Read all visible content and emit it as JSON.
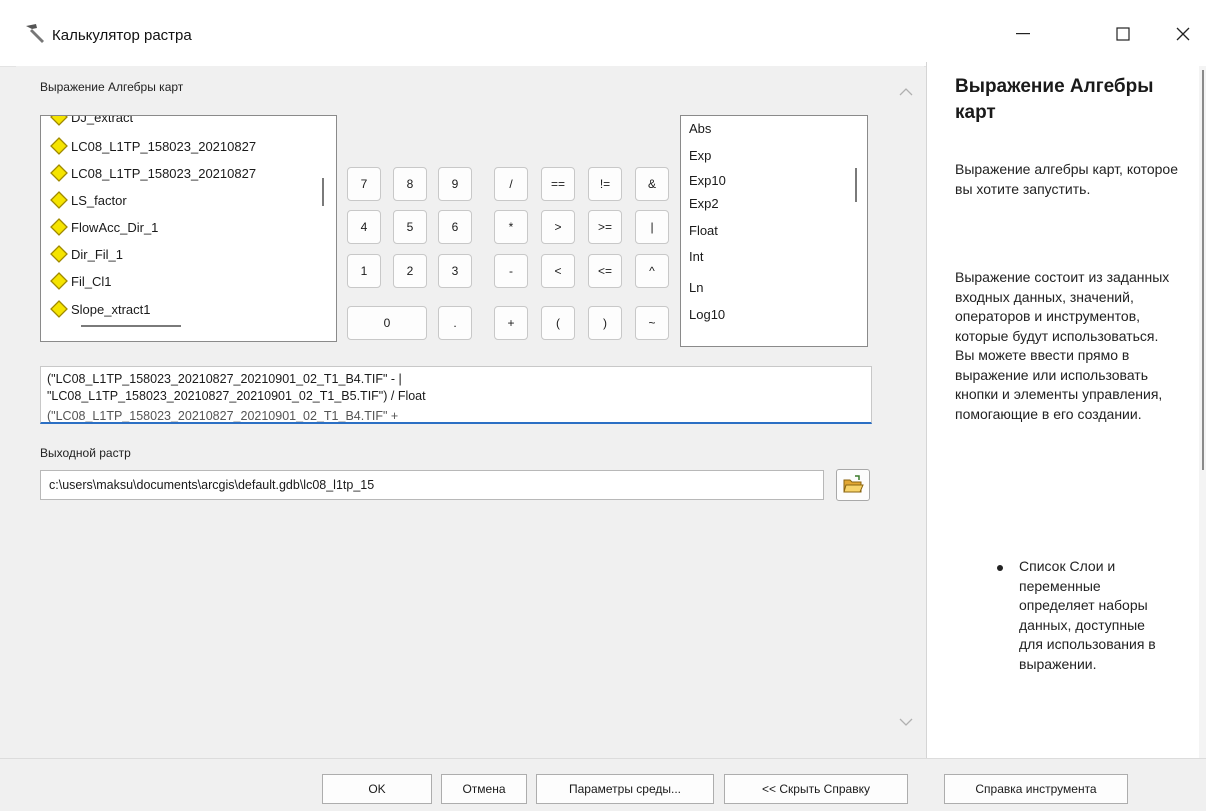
{
  "window": {
    "title": "Калькулятор растра"
  },
  "labels": {
    "map_algebra": "Выражение Алгебры карт",
    "output_raster": "Выходной растр"
  },
  "layers": {
    "partial_top": "DJ_extract",
    "items": [
      "LC08_L1TP_158023_20210827",
      "LC08_L1TP_158023_20210827",
      "LS_factor",
      "FlowAcc_Dir_1",
      "Dir_Fil_1",
      "Fil_Cl1"
    ],
    "partial_bottom": "Slope_xtract1",
    "icon": "diamond-layer-icon"
  },
  "calculator": {
    "row1": [
      "7",
      "8",
      "9",
      "/",
      "==",
      "!=",
      "&"
    ],
    "row2": [
      "4",
      "5",
      "6",
      "*",
      ">",
      ">=",
      "|"
    ],
    "row3": [
      "1",
      "2",
      "3",
      "-",
      "<",
      "<=",
      "^"
    ],
    "row4": [
      "0",
      ".",
      "+",
      "(",
      ")",
      "~"
    ]
  },
  "functions": [
    "Abs",
    "Exp",
    "Exp10",
    "Exp2",
    "Float",
    "Int",
    "Ln",
    "Log10"
  ],
  "expression": {
    "line1": "(\"LC08_L1TP_158023_20210827_20210901_02_T1_B4.TIF\" - |",
    "line2": "\"LC08_L1TP_158023_20210827_20210901_02_T1_B5.TIF\") / Float",
    "line3": "(\"LC08_L1TP_158023_20210827_20210901_02_T1_B4.TIF\" +"
  },
  "output": {
    "path": "c:\\users\\maksu\\documents\\arcgis\\default.gdb\\lc08_l1tp_15"
  },
  "help": {
    "title": "Выражение Алгебры карт",
    "para1": "Выражение алгебры карт, которое вы хотите запустить.",
    "para2": "Выражение состоит из заданных входных данных, значений, операторов и инструментов, которые будут использоваться. Вы можете ввести прямо в выражение или использовать кнопки и элементы управления, помогающие в его создании.",
    "bullet1": "Список Слои и переменные определяет наборы данных, доступные для использования в выражении."
  },
  "buttons": {
    "ok": "OK",
    "cancel": "Отмена",
    "env": "Параметры среды...",
    "hide_help": "<< Скрыть Справку",
    "tool_help": "Справка инструмента"
  },
  "colors": {
    "accent": "#2b6fc4",
    "diamond_fill": "#f5e400",
    "diamond_stroke": "#a08a00",
    "folder": "#f2c24a"
  }
}
